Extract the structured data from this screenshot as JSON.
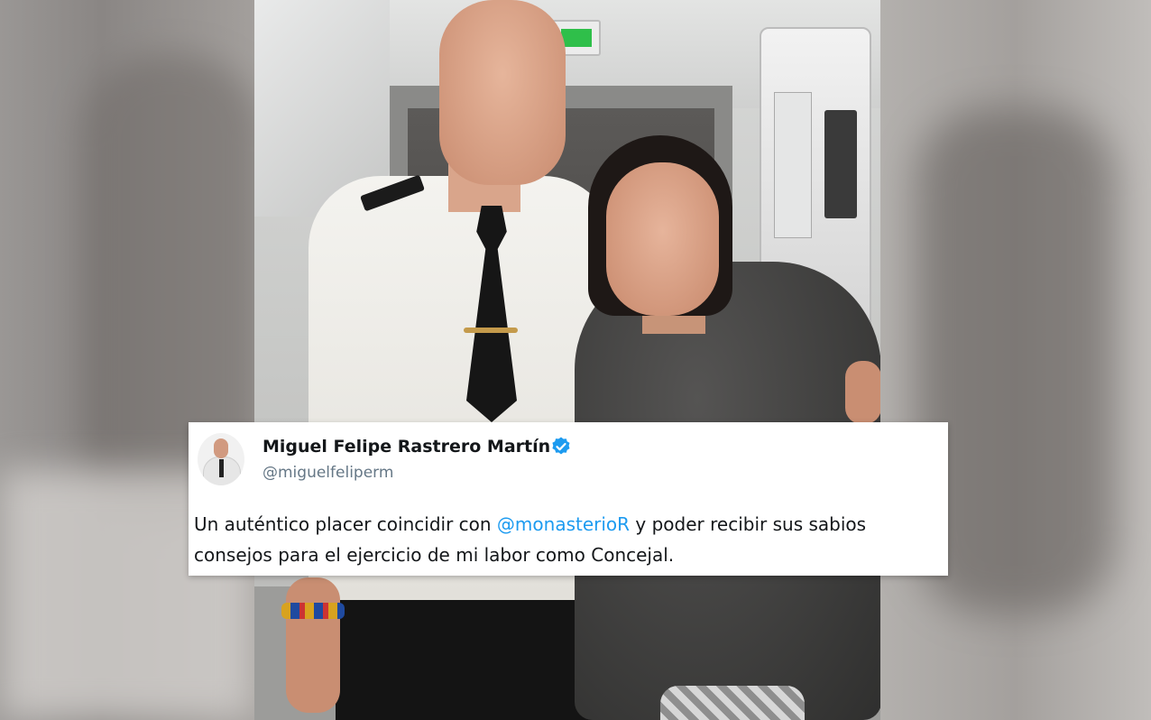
{
  "tweet": {
    "display_name": "Miguel Felipe Rastrero Martín",
    "handle": "@miguelfeliperm",
    "text_before": "Un auténtico placer coincidir con ",
    "mention": "@monasterioR",
    "text_after": " y poder recibir sus sabios consejos para el ejercicio de mi labor como Concejal.",
    "verified_icon": "verified-badge-icon",
    "colors": {
      "mention": "#1d9bf0",
      "verified": "#1d9bf0",
      "handle": "#657786"
    }
  },
  "scene": {
    "icons": [
      "exit-sign",
      "avatar"
    ]
  }
}
